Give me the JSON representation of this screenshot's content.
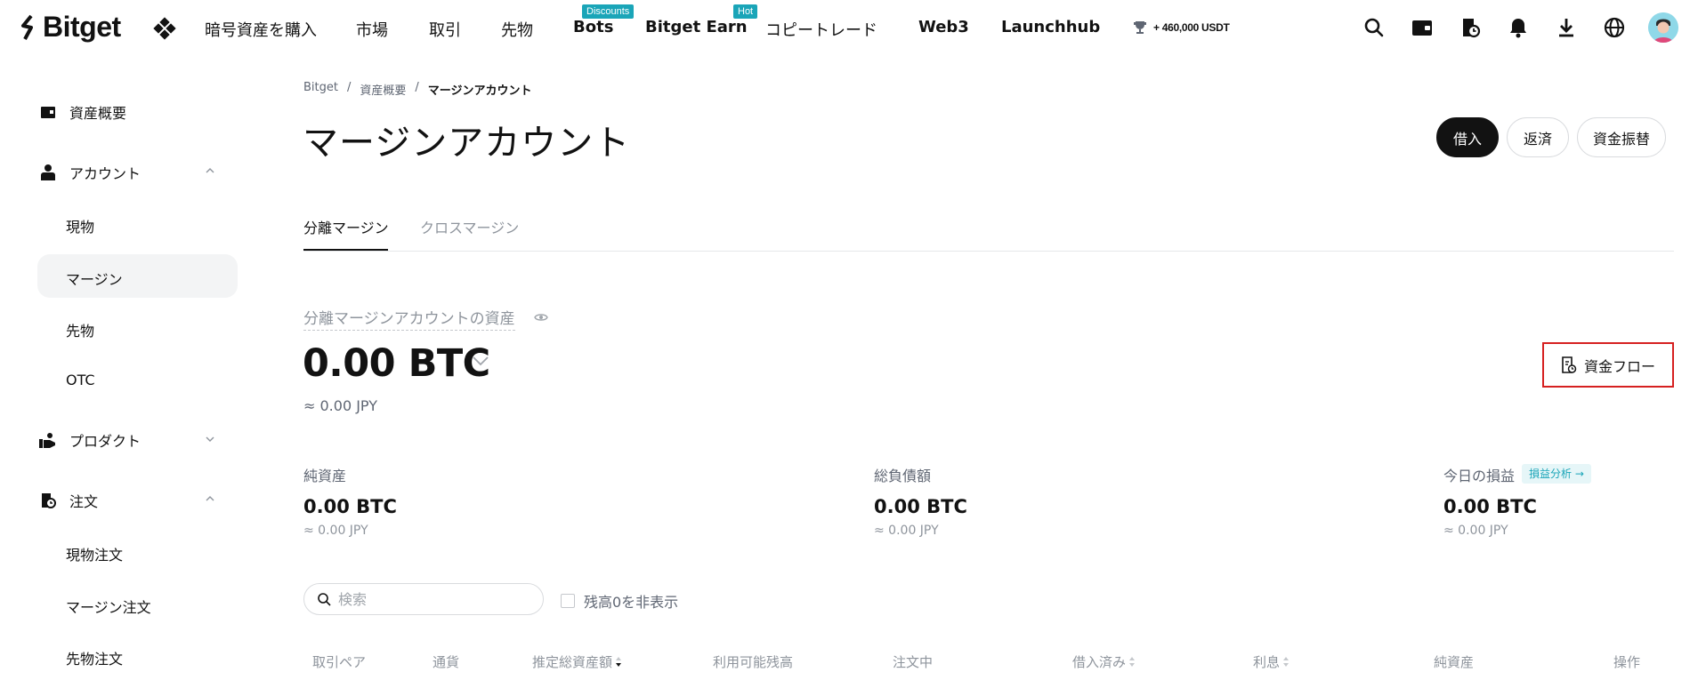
{
  "brand": {
    "name": "Bitget"
  },
  "nav": {
    "items": [
      {
        "label": "暗号資産を購入",
        "badge": ""
      },
      {
        "label": "市場",
        "badge": ""
      },
      {
        "label": "取引",
        "badge": ""
      },
      {
        "label": "先物",
        "badge": ""
      },
      {
        "label": "Bots",
        "badge": "Discounts"
      },
      {
        "label": "Bitget Earn",
        "badge": "Hot"
      },
      {
        "label": "コピートレード",
        "badge": ""
      },
      {
        "label": "Web3",
        "badge": ""
      },
      {
        "label": "Launchhub",
        "badge": ""
      }
    ],
    "promo": "+ 460,000 USDT",
    "icons": [
      "search-icon",
      "wallet-icon",
      "orders-icon",
      "bell-icon",
      "download-icon",
      "globe-icon",
      "avatar"
    ]
  },
  "sidebar": {
    "overview": "資産概要",
    "account": "アカウント",
    "account_children": [
      "現物",
      "マージン",
      "先物",
      "OTC"
    ],
    "product": "プロダクト",
    "orders": "注文",
    "orders_children": [
      "現物注文",
      "マージン注文",
      "先物注文"
    ]
  },
  "breadcrumb": [
    "Bitget",
    "資産概要",
    "マージンアカウント"
  ],
  "breadcrumb_sep": "/",
  "page": {
    "title": "マージンアカウント",
    "actions": {
      "borrow": "借入",
      "repay": "返済",
      "transfer": "資金振替"
    },
    "tabs": [
      "分離マージン",
      "クロスマージン"
    ],
    "active_tab": "分離マージン"
  },
  "assets": {
    "label": "分離マージンアカウントの資産",
    "amount": "0.00 BTC",
    "fiat": "≈ 0.00 JPY",
    "flow_button": "資金フロー",
    "stats": [
      {
        "label": "純資産",
        "value": "0.00 BTC",
        "fiat": "≈ 0.00 JPY"
      },
      {
        "label": "総負債額",
        "value": "0.00 BTC",
        "fiat": "≈ 0.00 JPY"
      },
      {
        "label": "今日の損益",
        "value": "0.00 BTC",
        "fiat": "≈ 0.00 JPY"
      }
    ],
    "pnl_analysis": "損益分析 →"
  },
  "filters": {
    "search_placeholder": "検索",
    "search_value": "",
    "hide_zero": "残高0を非表示"
  },
  "table": {
    "columns": [
      "取引ペア",
      "通貨",
      "推定総資産額",
      "利用可能残高",
      "注文中",
      "借入済み",
      "利息",
      "純資産",
      "操作"
    ]
  },
  "colors": {
    "accent": "#1aa5b8",
    "primary": "#121212",
    "highlight_border": "#d62020"
  }
}
